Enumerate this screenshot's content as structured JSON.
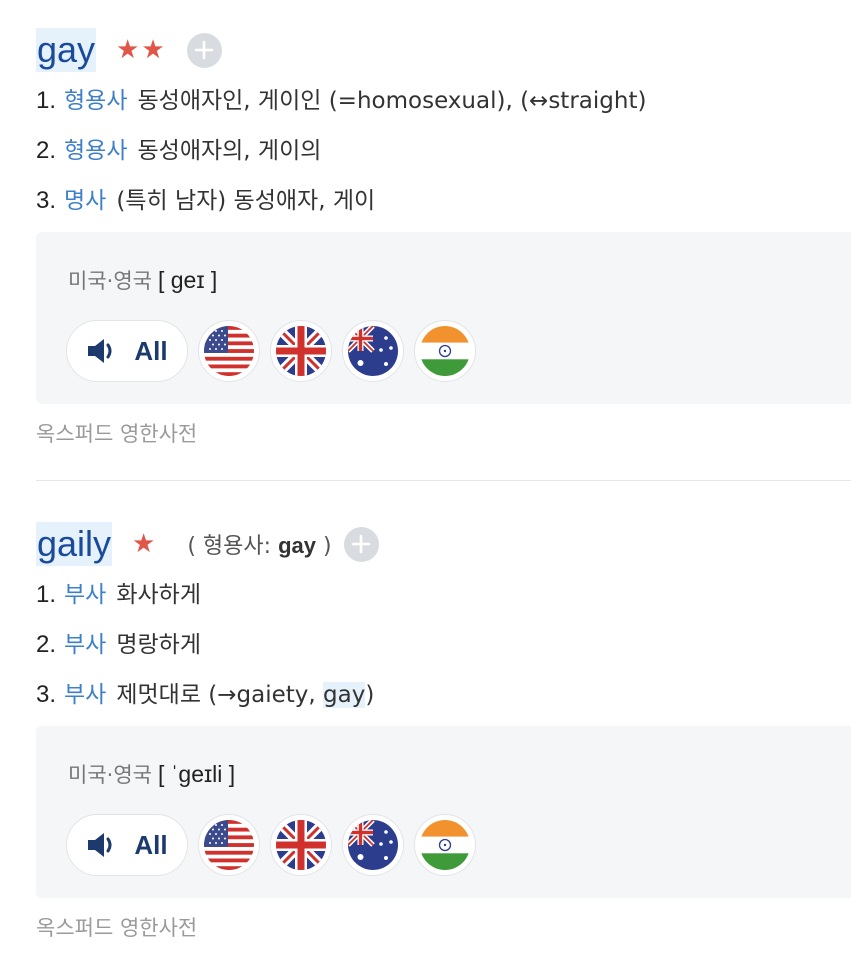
{
  "entries": [
    {
      "word": "gay",
      "stars": "★★",
      "senses": [
        {
          "num": "1.",
          "pos": "형용사",
          "def": "동성애자인, 게이인 (=homosexual), (↔straight)"
        },
        {
          "num": "2.",
          "pos": "형용사",
          "def": "동성애자의, 게이의"
        },
        {
          "num": "3.",
          "pos": "명사",
          "def": "(특히 남자) 동성애자, 게이"
        }
      ],
      "pron_label": "미국·영국",
      "ipa": "[ geɪ ]",
      "all_label": "All",
      "flags": [
        "us-flag-icon",
        "uk-flag-icon",
        "au-flag-icon",
        "in-flag-icon"
      ],
      "source": "옥스퍼드 영한사전"
    },
    {
      "word": "gaily",
      "stars": "★",
      "lemma_prefix": "( 형용사: ",
      "lemma_word": "gay",
      "lemma_suffix": " )",
      "senses": [
        {
          "num": "1.",
          "pos": "부사",
          "def": "화사하게"
        },
        {
          "num": "2.",
          "pos": "부사",
          "def": "명랑하게"
        },
        {
          "num": "3.",
          "pos": "부사",
          "def_prefix": "제멋대로 (→gaiety, ",
          "def_hl": "gay",
          "def_suffix": ")"
        }
      ],
      "pron_label": "미국·영국",
      "ipa": "[ ˈgeɪli ]",
      "all_label": "All",
      "flags": [
        "us-flag-icon",
        "uk-flag-icon",
        "au-flag-icon",
        "in-flag-icon"
      ],
      "source": "옥스퍼드 영한사전"
    }
  ],
  "colors": {
    "word": "#1a4a9c",
    "word_highlight": "#e6f2fb",
    "star": "#e0574a",
    "pos": "#3e80c8",
    "pron_box": "#f5f6f7"
  }
}
